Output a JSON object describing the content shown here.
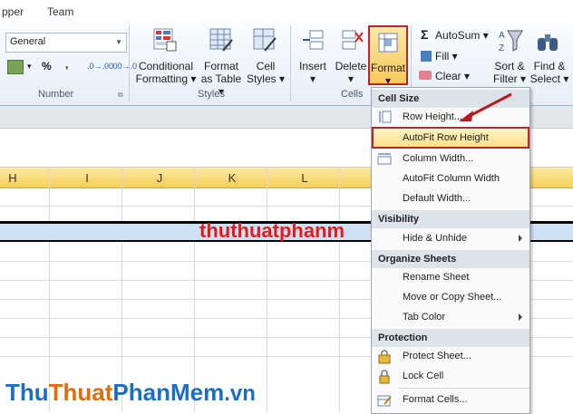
{
  "tabs": [
    "pper",
    "Team"
  ],
  "ribbon": {
    "number_format": "General",
    "number_symbols": [
      "%",
      ",",
      ".0→.00",
      ".00→.0"
    ],
    "groups": {
      "number": "Number",
      "styles": "Styles",
      "cells": "Cells"
    },
    "styles_buttons": [
      {
        "line1": "Conditional",
        "line2": "Formatting ▾"
      },
      {
        "line1": "Format",
        "line2": "as Table ▾"
      },
      {
        "line1": "Cell",
        "line2": "Styles ▾"
      }
    ],
    "cells_buttons": [
      {
        "line1": "Insert",
        "line2": "▾"
      },
      {
        "line1": "Delete",
        "line2": "▾"
      },
      {
        "line1": "Format",
        "line2": "▾"
      }
    ],
    "editing": {
      "autosum": "AutoSum ▾",
      "fill": "Fill ▾",
      "clear": "Clear ▾",
      "sort_l1": "Sort &",
      "sort_l2": "Filter ▾",
      "find_l1": "Find &",
      "find_l2": "Select ▾"
    }
  },
  "grid": {
    "columns": [
      "H",
      "I",
      "J",
      "K",
      "L"
    ],
    "overlay_text": "thuthuatphanm"
  },
  "menu": {
    "sections": [
      {
        "header": "Cell Size",
        "items": [
          {
            "label": "Row Height...",
            "icon": "row-height-icon"
          },
          {
            "label": "AutoFit Row Height",
            "icon": ""
          },
          {
            "label": "Column Width...",
            "icon": "column-width-icon"
          },
          {
            "label": "AutoFit Column Width",
            "icon": ""
          },
          {
            "label": "Default Width...",
            "icon": ""
          }
        ]
      },
      {
        "header": "Visibility",
        "items": [
          {
            "label": "Hide & Unhide",
            "submenu": true
          }
        ]
      },
      {
        "header": "Organize Sheets",
        "items": [
          {
            "label": "Rename Sheet"
          },
          {
            "label": "Move or Copy Sheet..."
          },
          {
            "label": "Tab Color",
            "submenu": true
          }
        ]
      },
      {
        "header": "Protection",
        "items": [
          {
            "label": "Protect Sheet...",
            "icon": "protect-icon"
          },
          {
            "label": "Lock Cell",
            "icon": "lock-icon"
          },
          {
            "label": "Format Cells...",
            "icon": "format-cells-icon"
          }
        ]
      }
    ]
  },
  "watermark": {
    "part1": "Thu",
    "part2": "Thuat",
    "part3": "PhanMem",
    "part4": ".vn"
  },
  "colors": {
    "highlight_border": "#b3282e",
    "arrow": "#c0171f",
    "watermark_blue": "#1a6ec8",
    "watermark_orange": "#e36c0a"
  }
}
